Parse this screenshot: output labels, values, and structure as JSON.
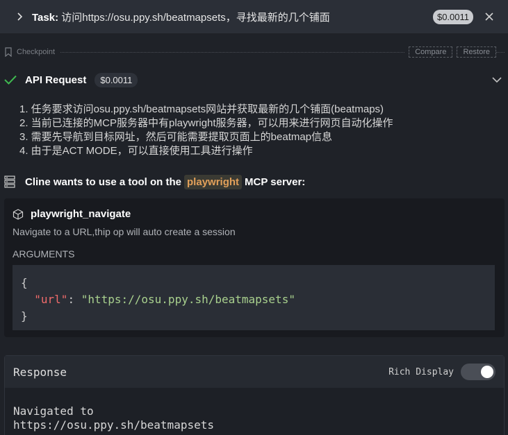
{
  "task": {
    "label": "Task:",
    "text": "访问https://osu.ppy.sh/beatmapsets，寻找最新的几个铺面",
    "cost": "$0.0011"
  },
  "checkpoint": {
    "label": "Checkpoint",
    "compare_label": "Compare",
    "restore_label": "Restore"
  },
  "api_request": {
    "title": "API Request",
    "cost": "$0.0011"
  },
  "steps": [
    "1. 任务要求访问osu.ppy.sh/beatmapsets网站并获取最新的几个铺面(beatmaps)",
    "2. 当前已连接的MCP服务器中有playwright服务器，可以用来进行网页自动化操作",
    "3. 需要先导航到目标网址，然后可能需要提取页面上的beatmap信息",
    "4. 由于是ACT MODE，可以直接使用工具进行操作"
  ],
  "tool_request": {
    "prefix": "Cline wants to use a tool on the",
    "server": "playwright",
    "suffix": "MCP server:"
  },
  "tool": {
    "name": "playwright_navigate",
    "description": "Navigate to a URL,thip op will auto create a session",
    "args_label": "ARGUMENTS",
    "code_open": "{",
    "arg_key": "\"url\"",
    "arg_colon": ": ",
    "arg_value": "\"https://osu.ppy.sh/beatmapsets\"",
    "code_close": "}"
  },
  "response": {
    "title": "Response",
    "rich_display_label": "Rich Display",
    "rich_display_on": true,
    "body_line1": "Navigated to",
    "body_line2": "https://osu.ppy.sh/beatmapsets"
  },
  "colors": {
    "success": "#3fb950",
    "server_accent": "#e2a05a",
    "json_key": "#f06b6b",
    "json_string": "#a9d18e"
  }
}
